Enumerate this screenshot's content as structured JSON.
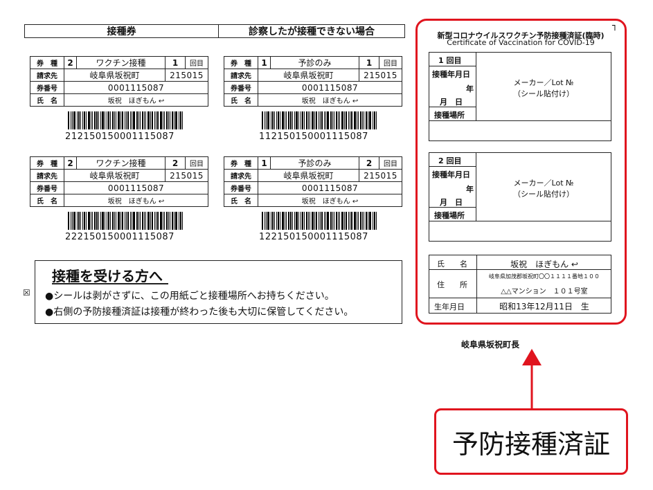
{
  "headers": {
    "left": "接種券",
    "right": "診察したが接種できない場合"
  },
  "tickets": [
    {
      "type_label": "券　種",
      "type_num": "2",
      "type_name": "ワクチン接種",
      "dose": "1",
      "dose_unit": "回目",
      "billing_label": "請求先",
      "billing": "岐阜県坂祝町",
      "code": "215015",
      "no_label": "券番号",
      "no": "0001115087",
      "name_label": "氏　名",
      "name": "坂祝　ほぎもん ↩",
      "barcode_num": "212150150001115087"
    },
    {
      "type_label": "券　種",
      "type_num": "1",
      "type_name": "予診のみ",
      "dose": "1",
      "dose_unit": "回目",
      "billing_label": "請求先",
      "billing": "岐阜県坂祝町",
      "code": "215015",
      "no_label": "券番号",
      "no": "0001115087",
      "name_label": "氏　名",
      "name": "坂祝　ほぎもん ↩",
      "barcode_num": "112150150001115087"
    },
    {
      "type_label": "券　種",
      "type_num": "2",
      "type_name": "ワクチン接種",
      "dose": "2",
      "dose_unit": "回目",
      "billing_label": "請求先",
      "billing": "岐阜県坂祝町",
      "code": "215015",
      "no_label": "券番号",
      "no": "0001115087",
      "name_label": "氏　名",
      "name": "坂祝　ほぎもん ↩",
      "barcode_num": "222150150001115087"
    },
    {
      "type_label": "券　種",
      "type_num": "1",
      "type_name": "予診のみ",
      "dose": "2",
      "dose_unit": "回目",
      "billing_label": "請求先",
      "billing": "岐阜県坂祝町",
      "code": "215015",
      "no_label": "券番号",
      "no": "0001115087",
      "name_label": "氏　名",
      "name": "坂祝　ほぎもん ↩",
      "barcode_num": "122150150001115087"
    }
  ],
  "notice": {
    "checkbox": "☒",
    "title": "接種を受ける方へ",
    "line1": "●シールは剥がさずに、この用紙ごと接種場所へお持ちください。",
    "line2": "●右側の予防接種済証は接種が終わった後も大切に保管してください。"
  },
  "certificate": {
    "title_ja": "新型コロナウイルスワクチン予防接種済証(臨時)",
    "title_en": "Certificate of Vaccination for COVID-19",
    "corner_mark": "┐",
    "doses": [
      {
        "dose": "1 回目",
        "date_label": "接種年月日",
        "year": "年",
        "month_day": "月　日",
        "place_label": "接種場所",
        "maker": "メーカー／Lot №",
        "sticker": "（シール貼付け）"
      },
      {
        "dose": "2 回目",
        "date_label": "接種年月日",
        "year": "年",
        "month_day": "月　日",
        "place_label": "接種場所",
        "maker": "メーカー／Lot №",
        "sticker": "（シール貼付け）"
      }
    ],
    "name_label": "氏　　名",
    "name": "坂祝　ほぎもん ↩",
    "address_label": "住　　所",
    "address1": "岐阜県加茂郡坂祝町〇〇１１１１番地１００",
    "address2": "△△マンション　１０１号室",
    "birth_label": "生年月日",
    "birth": "昭和13年12月11日　生"
  },
  "issuer": "岐阜県坂祝町長",
  "callout": {
    "label": "予防接種済証",
    "color": "#e0141e"
  },
  "colors": {
    "highlight": "#e0141e",
    "ink": "#222222"
  }
}
